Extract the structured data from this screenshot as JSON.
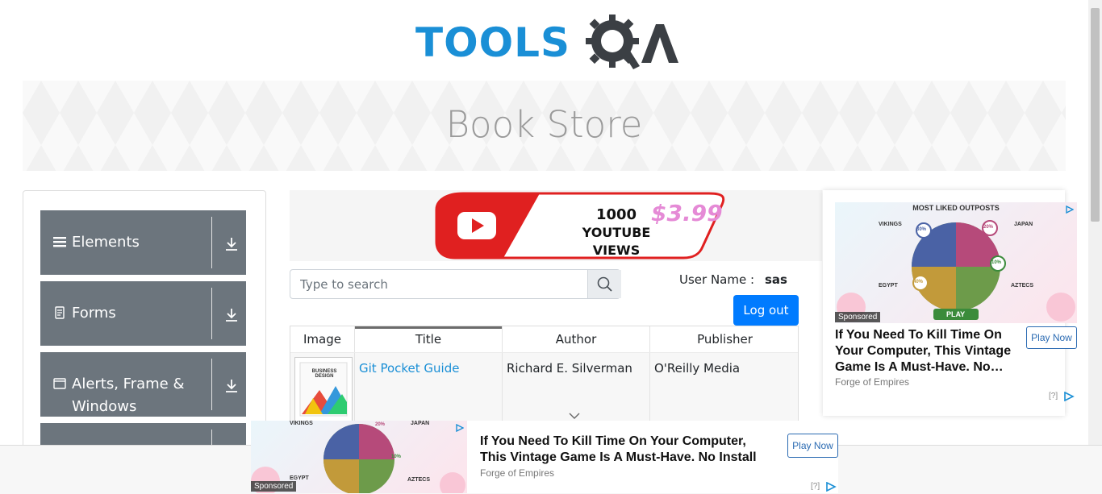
{
  "header": {
    "logo_text": "TOOLSQA",
    "logo_tools": "TOOLS"
  },
  "banner": {
    "title": "Book Store"
  },
  "sidebar": {
    "groups": [
      {
        "label": "Elements",
        "icon": "hamburger-icon"
      },
      {
        "label": "Forms",
        "icon": "document-icon"
      },
      {
        "label": "Alerts, Frame & Windows",
        "icon": "window-icon"
      },
      {
        "label": "",
        "icon": ""
      }
    ]
  },
  "top_ad": {
    "line1": "1000",
    "line2": "YOUTUBE VIEWS",
    "price": "$3.99"
  },
  "search": {
    "placeholder": "Type to search",
    "value": ""
  },
  "user": {
    "label": "User Name :",
    "value": "sas",
    "logout_label": "Log out"
  },
  "table": {
    "headers": [
      "Image",
      "Title",
      "Author",
      "Publisher"
    ],
    "rows": [
      {
        "title": "Git Pocket Guide",
        "author": "Richard E. Silverman",
        "publisher": "O'Reilly Media",
        "thumb_text": "BUSINESS DESIGN"
      }
    ]
  },
  "right_ad": {
    "heading": "MOST LIKED OUTPOSTS",
    "labels": [
      "VIKINGS",
      "JAPAN",
      "EGYPT",
      "AZTECS"
    ],
    "percents": [
      "30%",
      "20%",
      "40%",
      "10%"
    ],
    "play": "PLAY",
    "sponsored": "Sponsored",
    "title": "If You Need To Kill Time On Your Computer, This Vintage Game Is A Must-Have. No…",
    "source": "Forge of Empires",
    "cta": "Play Now",
    "info": "[?]"
  },
  "bottom_ad": {
    "sponsored": "Sponsored",
    "labels": [
      "VIKINGS",
      "JAPAN",
      "EGYPT",
      "AZTECS"
    ],
    "percents": [
      "20%",
      "10%",
      "40%"
    ],
    "title": "If You Need To Kill Time On Your Computer, This Vintage Game Is A Must-Have. No Install",
    "source": "Forge of Empires",
    "cta": "Play Now",
    "info": "[?]"
  },
  "colors": {
    "brand_blue": "#1a8fd6",
    "sidebar_gray": "#6c757d",
    "primary": "#007bff",
    "link": "#1a8fd6"
  }
}
